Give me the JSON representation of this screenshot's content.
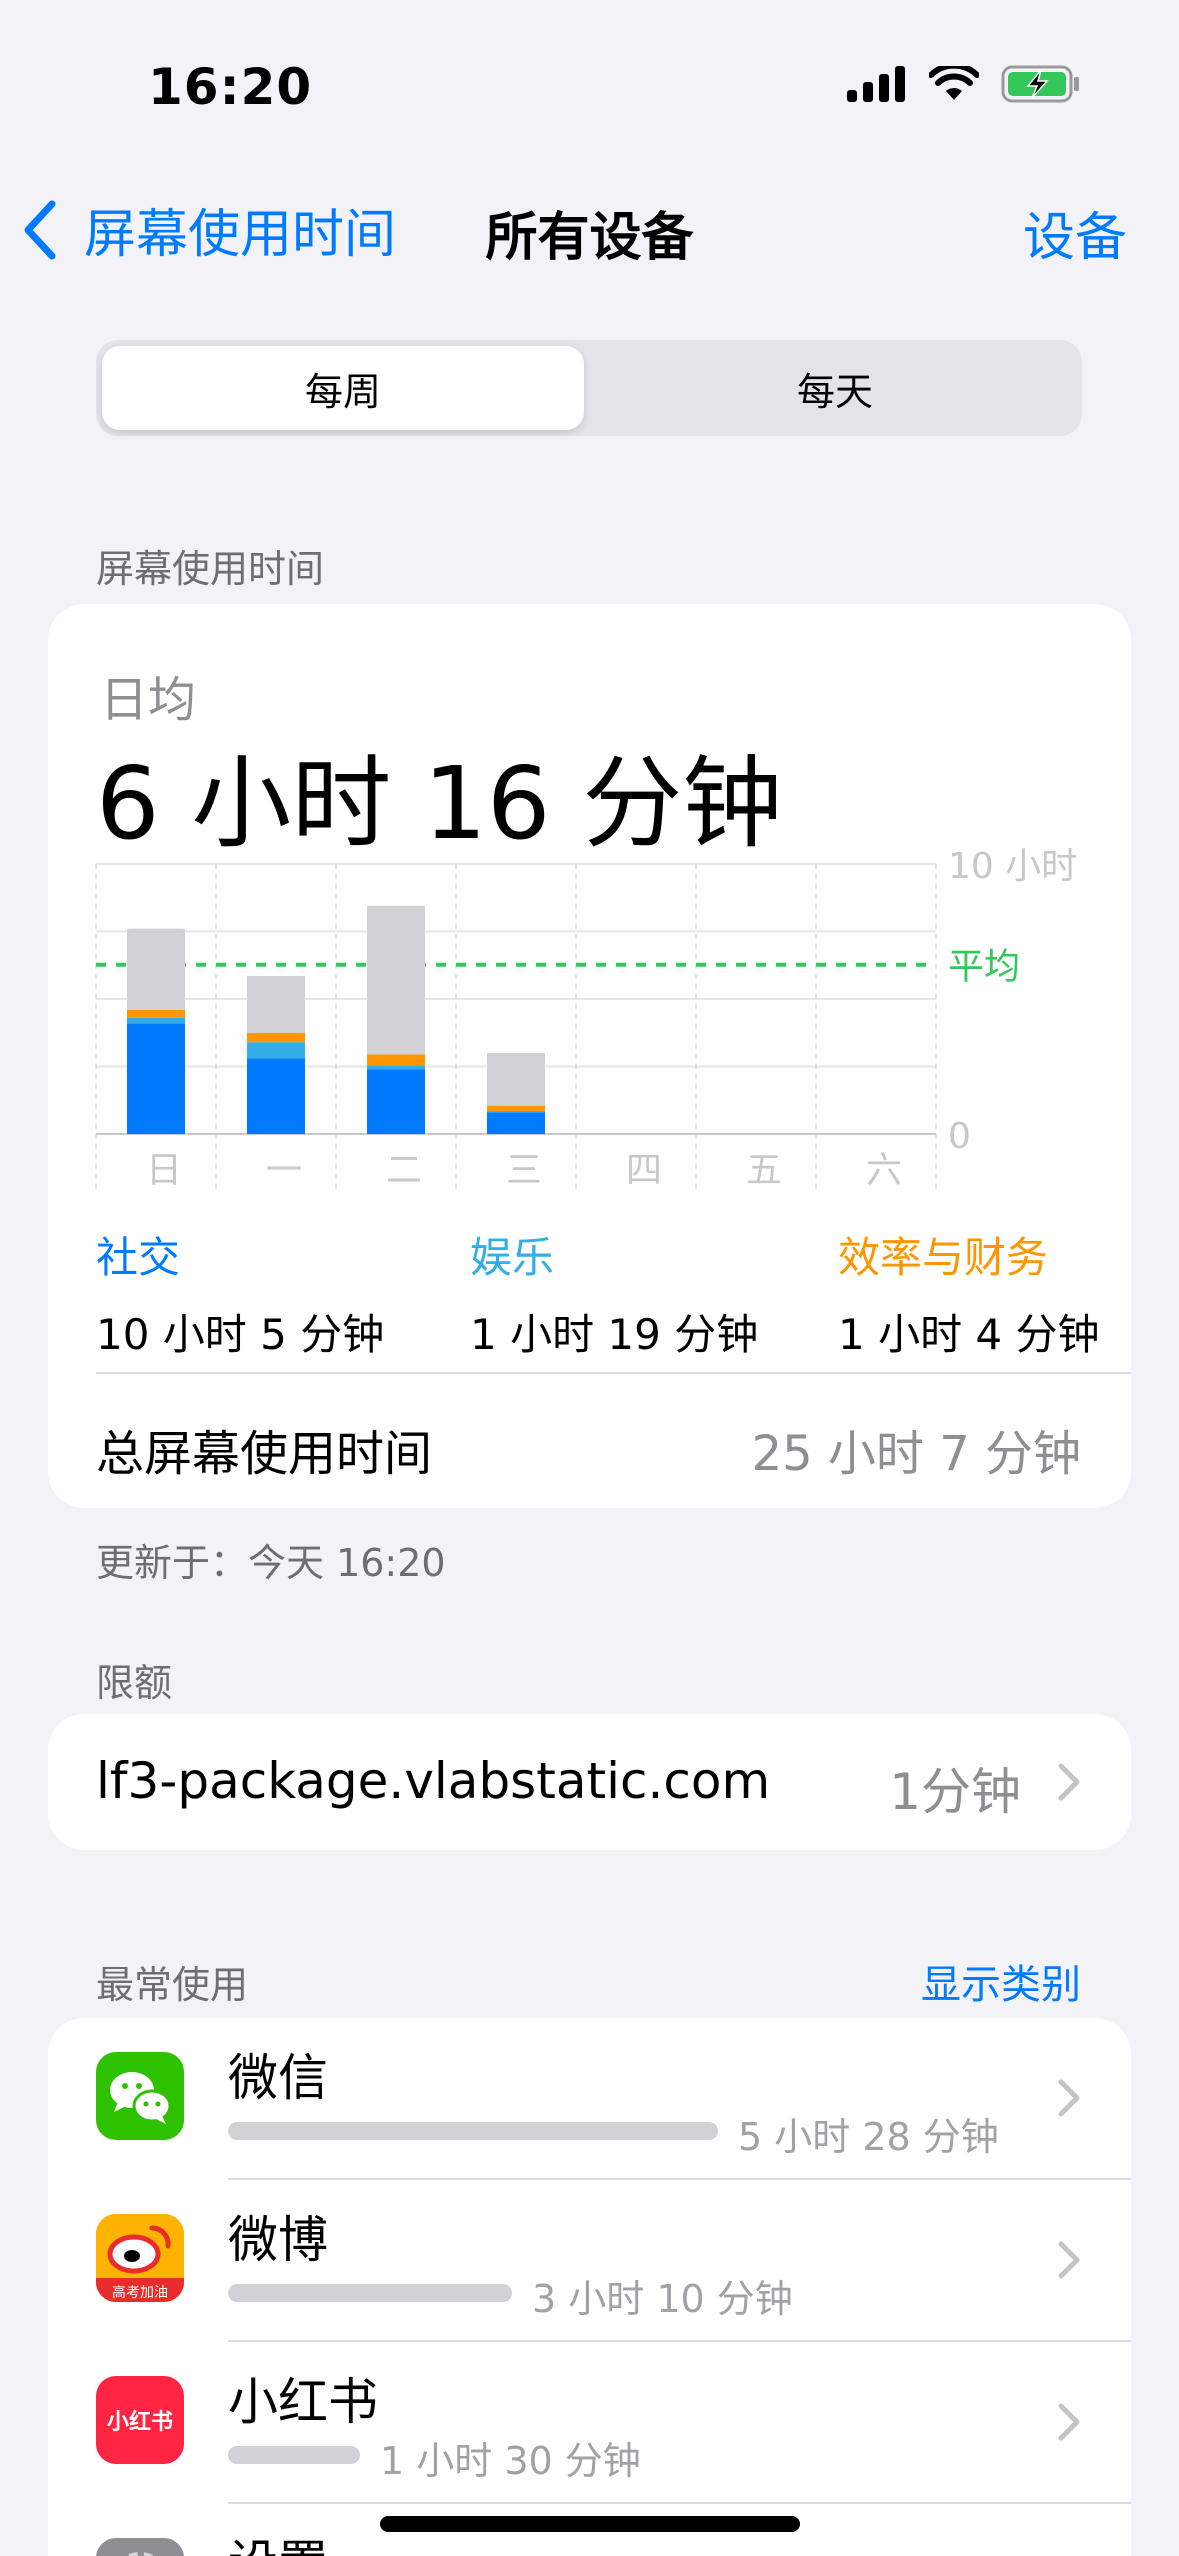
{
  "status": {
    "time": "16:20"
  },
  "nav": {
    "back_label": "屏幕使用时间",
    "title": "所有设备",
    "right_label": "设备"
  },
  "segment": {
    "weekly": "每周",
    "daily": "每天"
  },
  "screen_time": {
    "section_label": "屏幕使用时间",
    "avg_label": "日均",
    "avg_value": "6 小时 16 分钟",
    "axis_top": "10 小时",
    "avg_line_label": "平均",
    "axis_zero": "0",
    "categories": [
      {
        "name": "社交",
        "value": "10 小时 5 分钟",
        "color": "#007aff"
      },
      {
        "name": "娱乐",
        "value": "1 小时 19 分钟",
        "color": "#32ade6"
      },
      {
        "name": "效率与财务",
        "value": "1 小时 4 分钟",
        "color": "#ff9500"
      }
    ],
    "total_label": "总屏幕使用时间",
    "total_value": "25 小时 7 分钟",
    "updated": "更新于：今天 16:20"
  },
  "chart_data": {
    "type": "bar",
    "categories": [
      "日",
      "一",
      "二",
      "三",
      "四",
      "五",
      "六"
    ],
    "ylim": [
      0,
      10
    ],
    "average": 6.27,
    "series": [
      {
        "name": "社交",
        "values": [
          4.1,
          2.8,
          2.4,
          0.8,
          0,
          0,
          0
        ],
        "color": "#007aff"
      },
      {
        "name": "娱乐",
        "values": [
          0.2,
          0.6,
          0.15,
          0.05,
          0,
          0,
          0
        ],
        "color": "#32ade6"
      },
      {
        "name": "效率与财务",
        "values": [
          0.3,
          0.35,
          0.4,
          0.2,
          0,
          0,
          0
        ],
        "color": "#ff9500"
      },
      {
        "values": [
          3.0,
          2.1,
          5.5,
          1.95,
          0,
          0,
          0
        ],
        "color": "#d1d1d6"
      }
    ]
  },
  "limits": {
    "section_label": "限额",
    "item_name": "lf3-package.vlabstatic.com",
    "item_value": "1分钟"
  },
  "most_used": {
    "section_label": "最常使用",
    "show_categories": "显示类别",
    "apps": [
      {
        "name": "微信",
        "time": "5 小时 28 分钟",
        "bar": 1.0,
        "icon": "wechat-icon"
      },
      {
        "name": "微博",
        "time": "3 小时 10 分钟",
        "bar": 0.58,
        "icon": "weibo-icon",
        "icon_text": "高考加油"
      },
      {
        "name": "小红书",
        "time": "1 小时 30 分钟",
        "bar": 0.27,
        "icon": "xiaohongshu-icon",
        "icon_text": "小红书"
      },
      {
        "name": "设置",
        "icon": "settings-icon"
      }
    ]
  }
}
